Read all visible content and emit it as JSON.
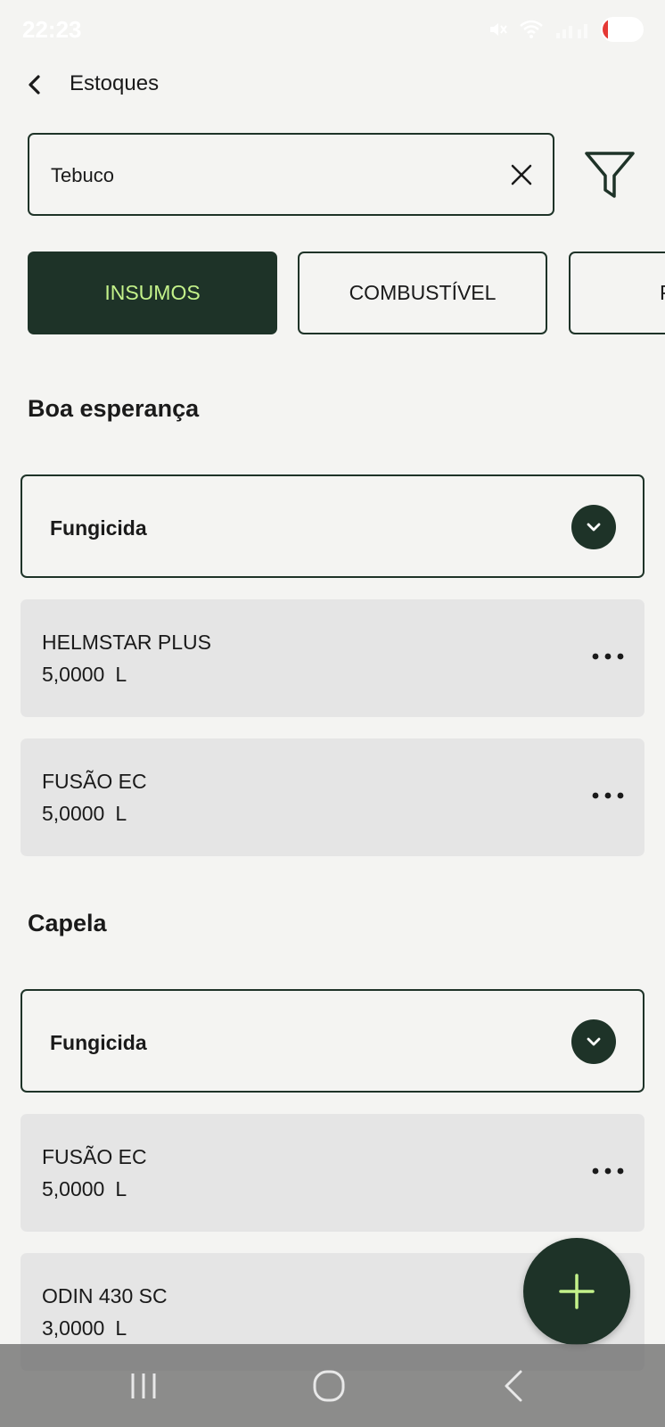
{
  "status_bar": {
    "time": "22:23",
    "battery_level": "13",
    "battery_fraction": 0.13,
    "icons": [
      "mute-icon",
      "wifi-icon",
      "signal-icon",
      "battery-icon"
    ]
  },
  "header": {
    "title": "Estoques"
  },
  "search": {
    "value": "Tebuco"
  },
  "tabs": [
    {
      "label": "INSUMOS",
      "active": true
    },
    {
      "label": "COMBUSTÍVEL",
      "active": false
    },
    {
      "label": "P",
      "active": false
    }
  ],
  "sections": [
    {
      "title": "Boa esperança",
      "category": "Fungicida",
      "products": [
        {
          "name": "HELMSTAR PLUS",
          "quantity": "5,0000",
          "unit": "L"
        },
        {
          "name": "FUSÃO EC",
          "quantity": "5,0000",
          "unit": "L"
        }
      ]
    },
    {
      "title": "Capela",
      "category": "Fungicida",
      "products": [
        {
          "name": "FUSÃO EC",
          "quantity": "5,0000",
          "unit": "L"
        },
        {
          "name": "ODIN 430 SC",
          "quantity": "3,0000",
          "unit": "L"
        }
      ]
    }
  ],
  "colors": {
    "primary_dark": "#1e3328",
    "accent_green": "#c4f28a",
    "card_background": "#e5e5e5",
    "page_background": "#f4f4f2"
  }
}
